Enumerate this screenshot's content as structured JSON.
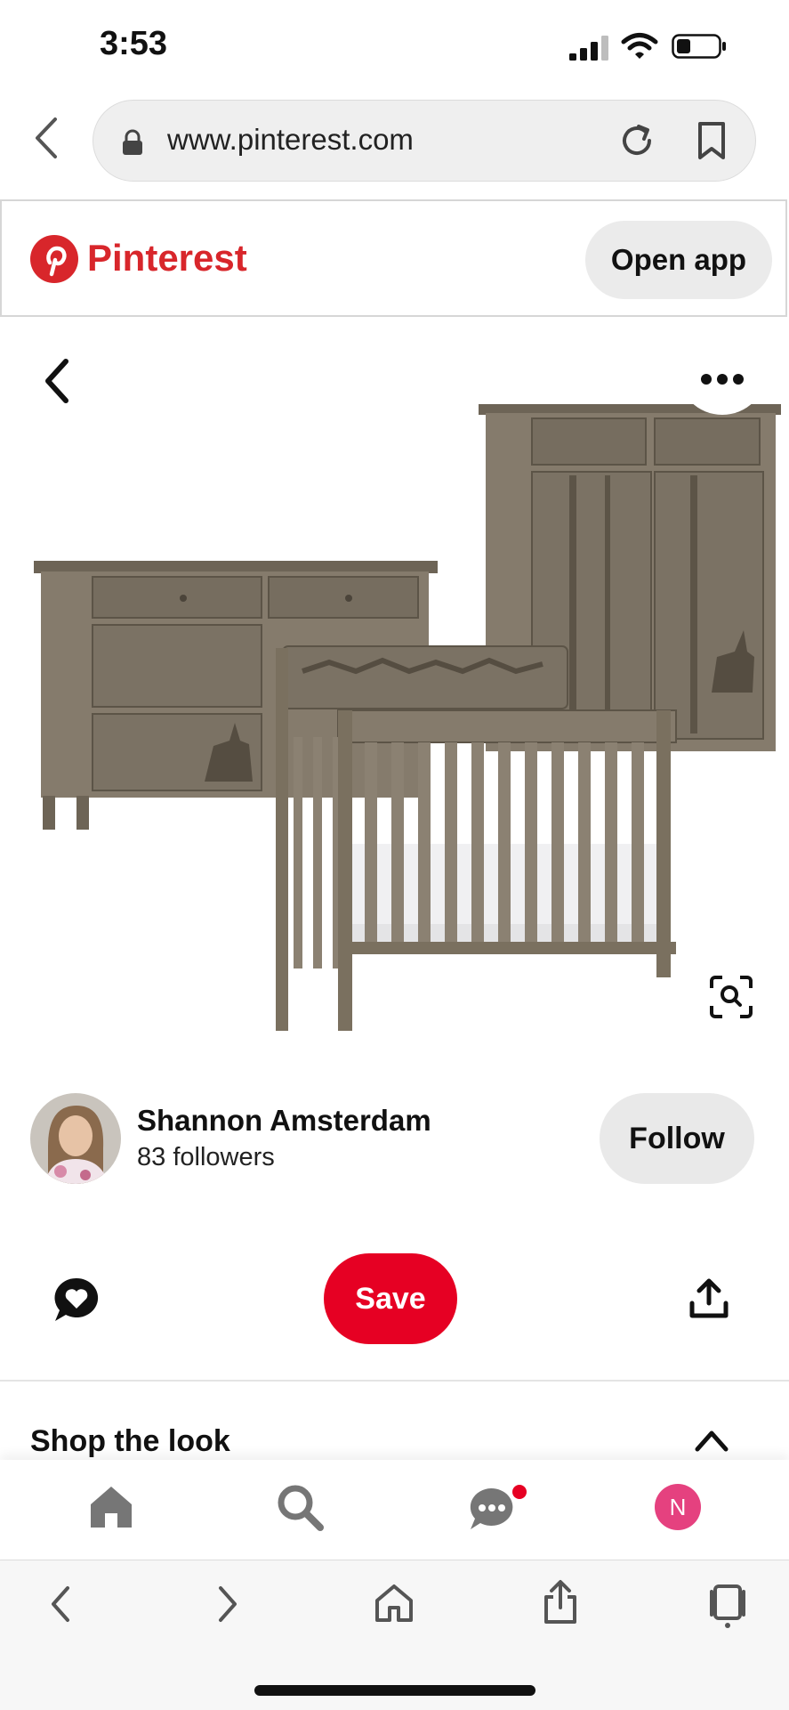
{
  "status_bar": {
    "time": "3:53",
    "battery_level": 0.3
  },
  "browser": {
    "url": "www.pinterest.com"
  },
  "site_header": {
    "brand": "Pinterest",
    "open_app_label": "Open app"
  },
  "pin": {
    "image_description_icon": "nursery-furniture-image",
    "creator_name": "Shannon Amsterdam",
    "followers": "83 followers",
    "follow_label": "Follow",
    "save_label": "Save",
    "shop_title": "Shop the look"
  },
  "tabbar": {
    "avatar_letter": "N",
    "accent": "#e5417f"
  },
  "colors": {
    "brand_red": "#d8262b",
    "save_red": "#e60023"
  }
}
